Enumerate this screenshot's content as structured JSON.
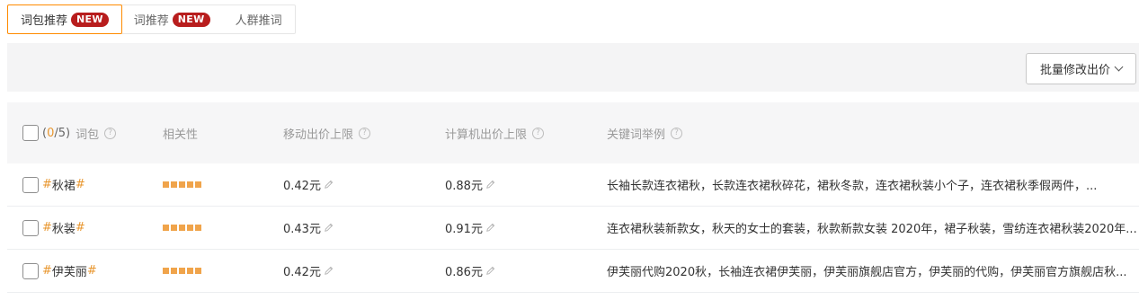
{
  "tabs": [
    {
      "label": "词包推荐",
      "badge": "NEW",
      "active": true
    },
    {
      "label": "词推荐",
      "badge": "NEW",
      "active": false
    },
    {
      "label": "人群推词",
      "badge": "",
      "active": false
    }
  ],
  "toolbar": {
    "batch_button_label": "批量修改出价"
  },
  "table": {
    "header": {
      "count_open": "(",
      "selected": "0",
      "total": "/5)",
      "col_keyword_pack": "词包",
      "col_relevance": "相关性",
      "col_mobile_bid": "移动出价上限",
      "col_pc_bid": "计算机出价上限",
      "col_examples": "关键词举例",
      "help_glyph": "?"
    },
    "rows": [
      {
        "hash": "#",
        "word": "秋裙",
        "relevance": 1.0,
        "mobile_bid": "0.42元",
        "pc_bid": "0.88元",
        "examples": "长袖长款连衣裙秋，长款连衣裙秋碎花，裙秋冬款，连衣裙秋装小个子，连衣裙秋季假两件，..."
      },
      {
        "hash": "#",
        "word": "秋装",
        "relevance": 1.0,
        "mobile_bid": "0.43元",
        "pc_bid": "0.91元",
        "examples": "连衣裙秋装新款女，秋天的女士的套装，秋款新款女装 2020年，裙子秋装，雪纺连衣裙秋装2020年..."
      },
      {
        "hash": "#",
        "word": "伊芙丽",
        "relevance": 1.0,
        "mobile_bid": "0.42元",
        "pc_bid": "0.86元",
        "examples": "伊芙丽代购2020秋，长袖连衣裙伊芙丽，伊芙丽旗舰店官方，伊芙丽的代购，伊芙丽官方旗舰店秋..."
      }
    ]
  },
  "colors": {
    "accent": "#ff8a00",
    "badge": "#b81d1d",
    "relevance_bar": "#f0a44b",
    "hash": "#e8962e"
  }
}
